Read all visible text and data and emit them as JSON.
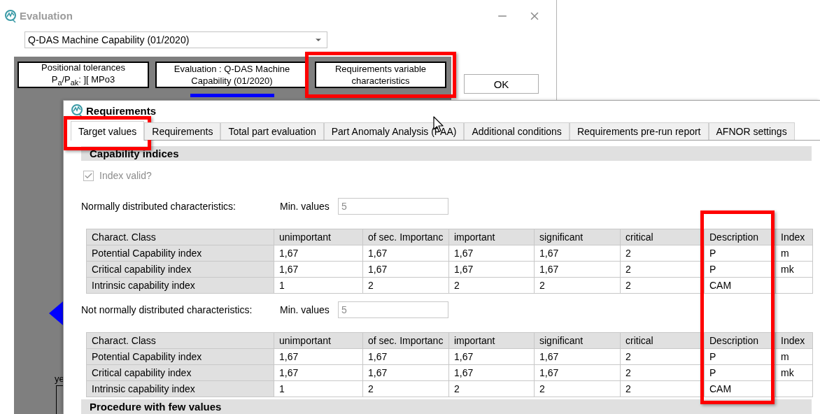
{
  "window": {
    "title": "Evaluation",
    "dropdown": {
      "value": "Q-DAS Machine Capability (01/2020)"
    }
  },
  "header_buttons": [
    {
      "label": "Positional tolerances\nP$_{a}$/P$_{ak}$: ][ MPo3",
      "highlighted": false
    },
    {
      "label": "Evaluation : Q-DAS Machine Capability (01/2020)",
      "highlighted": false
    },
    {
      "label": "Requirements variable characteristics",
      "highlighted": true
    }
  ],
  "ok_button": "OK",
  "partial_label": "ye",
  "dialog": {
    "title": "Requirements",
    "tabs": [
      {
        "label": "Target values",
        "selected": true,
        "highlighted": true
      },
      {
        "label": "Requirements",
        "selected": false,
        "highlighted": false
      },
      {
        "label": "Total part evaluation",
        "selected": false,
        "highlighted": false
      },
      {
        "label": "Part Anomaly Analysis (PAA)",
        "selected": false,
        "highlighted": false
      },
      {
        "label": "Additional conditions",
        "selected": false,
        "highlighted": false
      },
      {
        "label": "Requirements pre-run report",
        "selected": false,
        "highlighted": false
      },
      {
        "label": "AFNOR settings",
        "selected": false,
        "highlighted": false
      }
    ],
    "section_title": "Capability indices",
    "index_valid": {
      "label": "Index valid?",
      "checked": true,
      "disabled": true
    },
    "description_column_highlighted": true,
    "tables": [
      {
        "label": "Normally distributed characteristics:",
        "min_values_label": "Min. values",
        "min_values": "5",
        "columns": [
          "Charact. Class",
          "unimportant",
          "of sec. Importanc",
          "important",
          "significant",
          "critical",
          "Description",
          "Index"
        ],
        "rows": [
          [
            "Potential Capability index",
            "1,67",
            "1,67",
            "1,67",
            "1,67",
            "2",
            "P",
            "m"
          ],
          [
            "Critical  capability index",
            "1,67",
            "1,67",
            "1,67",
            "1,67",
            "2",
            "P",
            "mk"
          ],
          [
            "Intrinsic capability index",
            "1",
            "2",
            "2",
            "2",
            "2",
            "CAM"
          ]
        ]
      },
      {
        "label": "Not normally distributed characteristics:",
        "min_values_label": "Min. values",
        "min_values": "5",
        "columns": [
          "Charact. Class",
          "unimportant",
          "of sec. Importanc",
          "important",
          "significant",
          "critical",
          "Description",
          "Index"
        ],
        "rows": [
          [
            "Potential Capability index",
            "1,67",
            "1,67",
            "1,67",
            "1,67",
            "2",
            "P",
            "m"
          ],
          [
            "Critical  capability index",
            "1,67",
            "1,67",
            "1,67",
            "1,67",
            "2",
            "P",
            "mk"
          ],
          [
            "Intrinsic capability index",
            "1",
            "2",
            "2",
            "2",
            "2",
            "CAM"
          ]
        ]
      }
    ],
    "footer_section_title": "Procedure with few values"
  }
}
